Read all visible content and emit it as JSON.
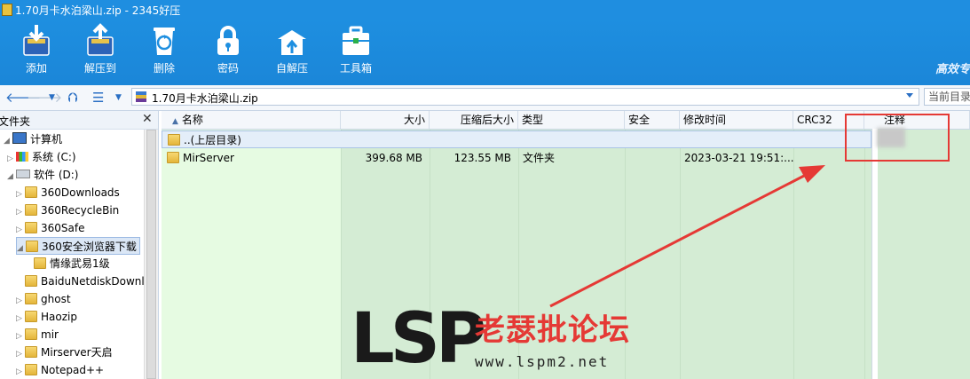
{
  "window": {
    "title": "1.70月卡水泊梁山.zip - 2345好压"
  },
  "toolbar": {
    "buttons": [
      {
        "label": "添加",
        "icon": "add-archive-icon"
      },
      {
        "label": "解压到",
        "icon": "extract-icon"
      },
      {
        "label": "删除",
        "icon": "recycle-delete-icon"
      },
      {
        "label": "密码",
        "icon": "lock-icon"
      },
      {
        "label": "自解压",
        "icon": "self-extract-icon"
      },
      {
        "label": "工具箱",
        "icon": "toolbox-icon"
      }
    ],
    "slogan": "高效专"
  },
  "address": {
    "path": "1.70月卡水泊梁山.zip",
    "search_placeholder": "当前目录"
  },
  "tree": {
    "header": "文件夹",
    "close": "✕",
    "nodes": [
      {
        "label": "计算机"
      },
      {
        "label": "系统 (C:)"
      },
      {
        "label": "软件 (D:)"
      },
      {
        "label": "360Downloads"
      },
      {
        "label": "360RecycleBin"
      },
      {
        "label": "360Safe"
      },
      {
        "label": "360安全浏览器下载"
      },
      {
        "label": "情缘武易1级"
      },
      {
        "label": "BaiduNetdiskDownl"
      },
      {
        "label": "ghost"
      },
      {
        "label": "Haozip"
      },
      {
        "label": "mir"
      },
      {
        "label": "Mirserver天启"
      },
      {
        "label": "Notepad++"
      }
    ]
  },
  "list": {
    "columns": [
      "名称",
      "大小",
      "压缩后大小",
      "类型",
      "安全",
      "修改时间",
      "CRC32",
      "注释"
    ],
    "parent_row": "..(上层目录)",
    "rows": [
      {
        "name": "MirServer",
        "size": "399.68 MB",
        "packed": "123.55 MB",
        "type": "文件夹",
        "security": "",
        "modified": "2023-03-21 19:51:...",
        "crc": "",
        "comment": ""
      }
    ]
  },
  "watermark": {
    "brand": "LSP",
    "name": "老瑟批论坛",
    "url": "www.lspm2.net"
  },
  "colors": {
    "toolbar_blue": "#1e8fe0",
    "annotation_red": "#e53935",
    "list_green": "#d4ecd4"
  }
}
